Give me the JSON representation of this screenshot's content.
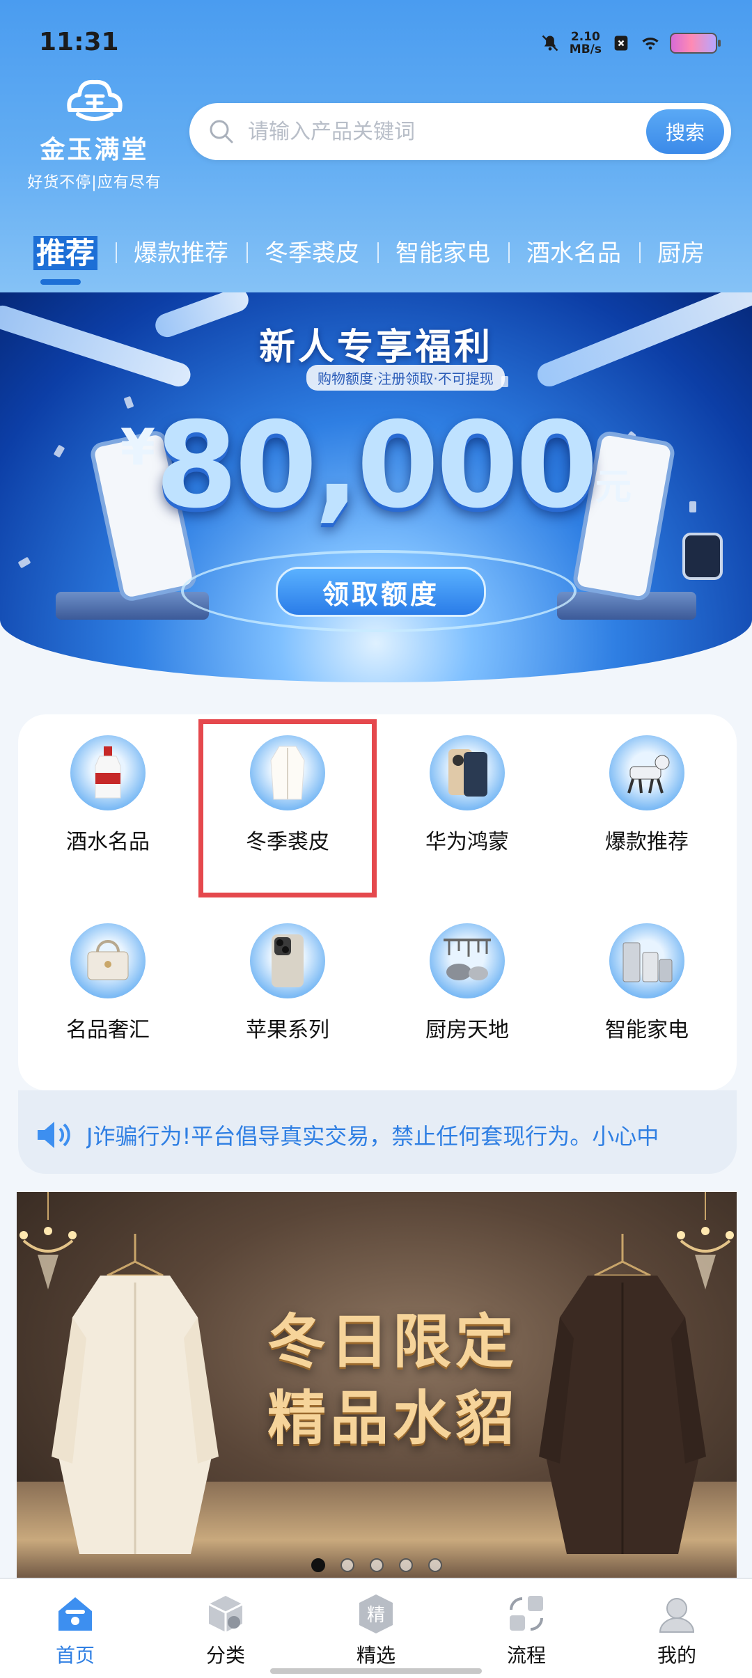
{
  "status_bar": {
    "time": "11:31",
    "speed_value": "2.10",
    "speed_unit": "MB/s"
  },
  "logo": {
    "name": "金玉满堂",
    "slogan": "好货不停|应有尽有"
  },
  "search": {
    "placeholder": "请输入产品关键词",
    "button_label": "搜索"
  },
  "tabs": [
    {
      "label": "推荐",
      "active": true
    },
    {
      "label": "爆款推荐"
    },
    {
      "label": "冬季裘皮"
    },
    {
      "label": "智能家电"
    },
    {
      "label": "酒水名品"
    },
    {
      "label": "厨房"
    }
  ],
  "hero_banner": {
    "title": "新人专享福利",
    "subtitle": "购物额度·注册领取·不可提现",
    "currency": "¥",
    "amount": "80,000",
    "unit": "元",
    "button_label": "领取额度"
  },
  "categories": [
    {
      "label": "酒水名品",
      "icon": "liquor-bottle-icon"
    },
    {
      "label": "冬季裘皮",
      "icon": "white-coat-icon",
      "selected": true
    },
    {
      "label": "华为鸿蒙",
      "icon": "huawei-phone-icon"
    },
    {
      "label": "爆款推荐",
      "icon": "robot-dog-icon"
    },
    {
      "label": "名品奢汇",
      "icon": "handbag-icon"
    },
    {
      "label": "苹果系列",
      "icon": "iphone-icon"
    },
    {
      "label": "厨房天地",
      "icon": "cookware-icon"
    },
    {
      "label": "智能家电",
      "icon": "appliances-icon"
    }
  ],
  "notice": {
    "text": "J诈骗行为!平台倡导真实交易，禁止任何套现行为。小心中"
  },
  "promo_banner": {
    "line1": "冬日限定",
    "line2": "精品水貂",
    "slide_count": 5,
    "active_slide": 1
  },
  "bottom_nav": [
    {
      "label": "首页",
      "icon": "home-icon",
      "active": true
    },
    {
      "label": "分类",
      "icon": "category-box-icon"
    },
    {
      "label": "精选",
      "icon": "featured-badge-icon",
      "badge": "精"
    },
    {
      "label": "流程",
      "icon": "process-flow-icon"
    },
    {
      "label": "我的",
      "icon": "profile-icon"
    }
  ],
  "colors": {
    "accent": "#2f7fe3",
    "header": "#4a9cf0",
    "highlight_box": "#e5484d"
  }
}
